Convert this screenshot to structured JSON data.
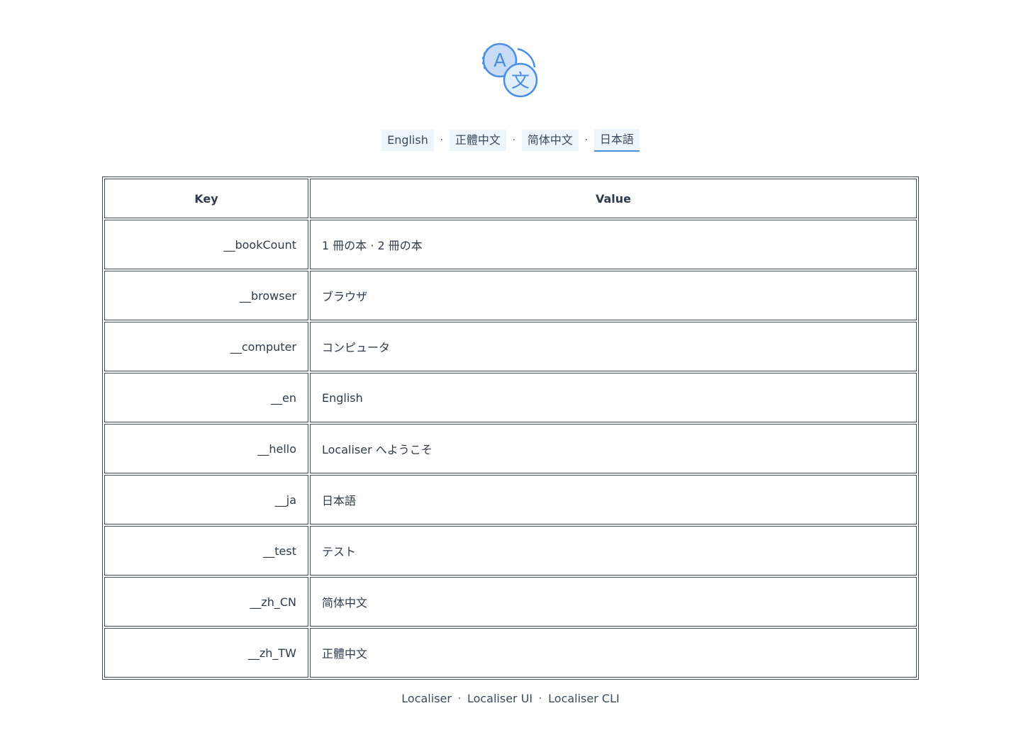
{
  "logo": {
    "icon": "translate-icon",
    "glyph_a": "A",
    "glyph_b": "文",
    "colors": {
      "stroke": "#4a8fe7",
      "fill_light": "#c9dcf7",
      "fill_pale": "#e3eefb"
    }
  },
  "language_nav": {
    "items": [
      {
        "label": "English",
        "active": false
      },
      {
        "label": "正體中文",
        "active": false
      },
      {
        "label": "简体中文",
        "active": false
      },
      {
        "label": "日本語",
        "active": true
      }
    ],
    "separator": "·"
  },
  "table": {
    "headers": {
      "key": "Key",
      "value": "Value"
    },
    "rows": [
      {
        "key": "__bookCount",
        "value": "1 冊の本 · 2 冊の本"
      },
      {
        "key": "__browser",
        "value": "ブラウザ"
      },
      {
        "key": "__computer",
        "value": "コンピュータ"
      },
      {
        "key": "__en",
        "value": "English"
      },
      {
        "key": "__hello",
        "value": "Localiser へようこそ"
      },
      {
        "key": "__ja",
        "value": "日本語"
      },
      {
        "key": "__test",
        "value": "テスト"
      },
      {
        "key": "__zh_CN",
        "value": "简体中文"
      },
      {
        "key": "__zh_TW",
        "value": "正體中文"
      }
    ]
  },
  "footer": {
    "links": [
      "Localiser",
      "Localiser UI",
      "Localiser CLI"
    ],
    "separator": "·"
  },
  "colors": {
    "accent": "#4a90e2",
    "nav_bg": "#eef5fc",
    "text": "#2f3b4d",
    "border": "#3a4a5c"
  }
}
